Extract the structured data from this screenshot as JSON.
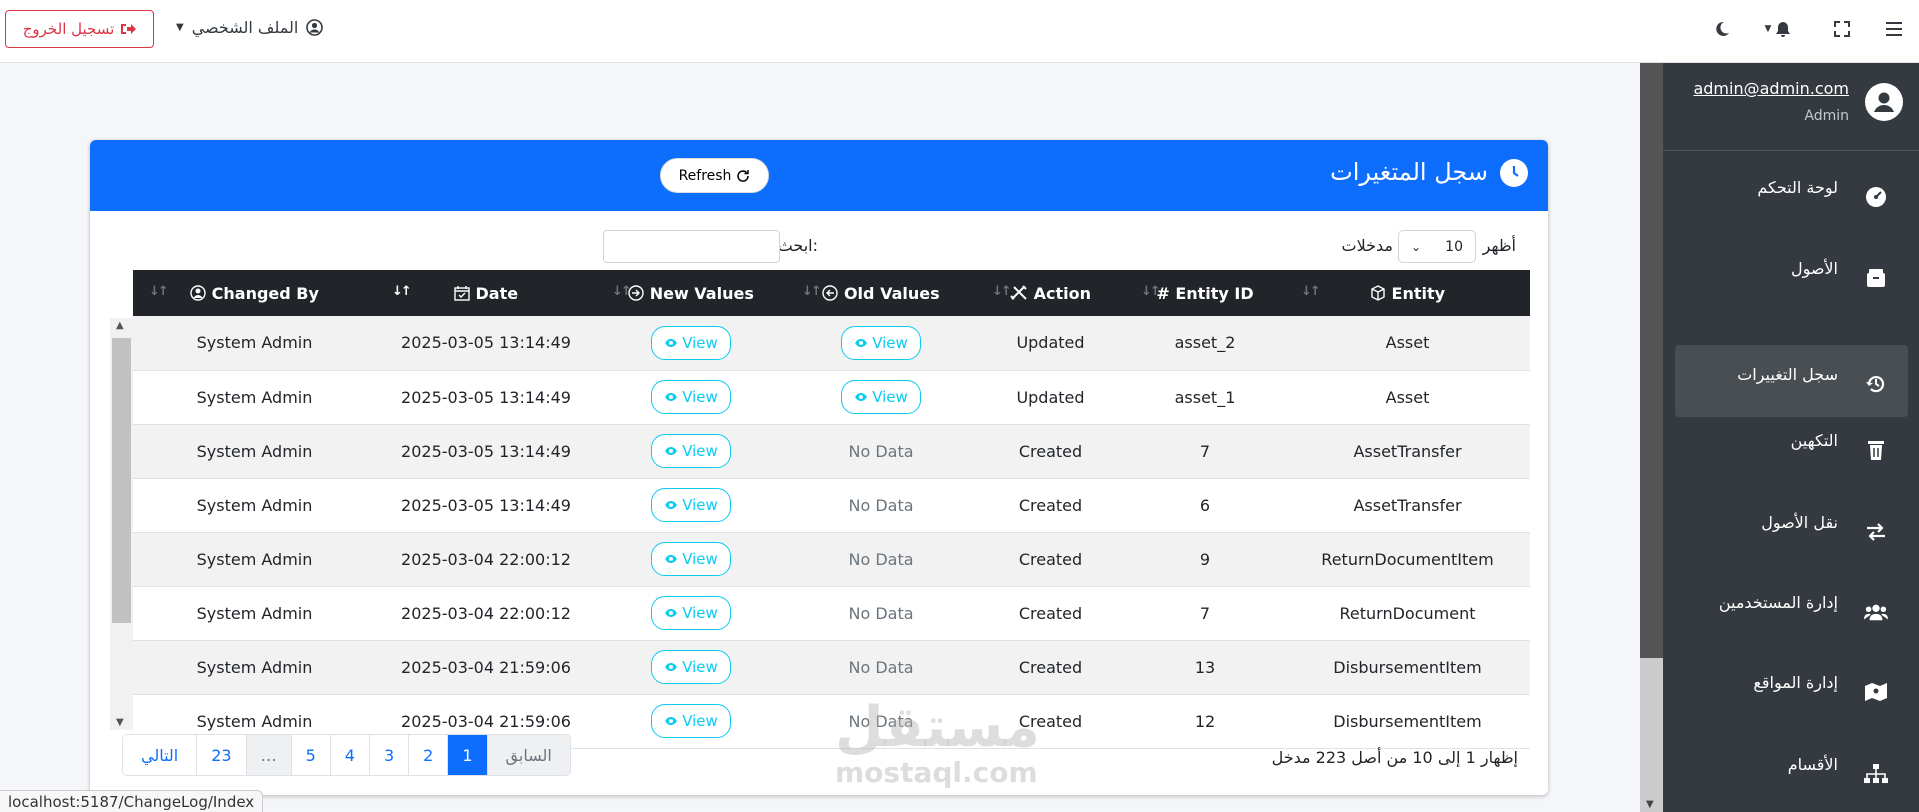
{
  "topbar": {
    "logout_label": "تسجيل الخروج",
    "profile_label": "الملف الشخصي"
  },
  "sidebar": {
    "user_email": "admin@admin.com",
    "user_role": "Admin",
    "items": [
      {
        "label": "لوحة التحكم",
        "icon": "dashboard-icon"
      },
      {
        "label": "الأصول",
        "icon": "box-icon"
      },
      {
        "label": "سجل التغييرات",
        "icon": "history-icon",
        "active": true
      },
      {
        "label": "التكهين",
        "icon": "trash-icon"
      },
      {
        "label": "نقل الأصول",
        "icon": "transfer-icon"
      },
      {
        "label": "إدارة المستخدمين",
        "icon": "users-icon"
      },
      {
        "label": "إدارة المواقع",
        "icon": "map-icon"
      },
      {
        "label": "الأقسام",
        "icon": "sitemap-icon"
      }
    ]
  },
  "card": {
    "title": "سجل المتغيرات",
    "refresh_label": "Refresh"
  },
  "controls": {
    "show_label": "أظهر",
    "page_length": "10",
    "entries_label": "مدخلات",
    "search_label": "ابحث:",
    "search_value": ""
  },
  "table": {
    "columns": [
      "Entity",
      "Entity ID",
      "Action",
      "Old Values",
      "New Values",
      "Date",
      "Changed By"
    ],
    "view_label": "View",
    "no_data_label": "No Data",
    "rows": [
      {
        "entity": "Asset",
        "entity_id": "asset_2",
        "action": "Updated",
        "old": "View",
        "new": "View",
        "date": "2025-03-05 13:14:49",
        "by": "System Admin"
      },
      {
        "entity": "Asset",
        "entity_id": "asset_1",
        "action": "Updated",
        "old": "View",
        "new": "View",
        "date": "2025-03-05 13:14:49",
        "by": "System Admin"
      },
      {
        "entity": "AssetTransfer",
        "entity_id": "7",
        "action": "Created",
        "old": "No Data",
        "new": "View",
        "date": "2025-03-05 13:14:49",
        "by": "System Admin"
      },
      {
        "entity": "AssetTransfer",
        "entity_id": "6",
        "action": "Created",
        "old": "No Data",
        "new": "View",
        "date": "2025-03-05 13:14:49",
        "by": "System Admin"
      },
      {
        "entity": "ReturnDocumentItem",
        "entity_id": "9",
        "action": "Created",
        "old": "No Data",
        "new": "View",
        "date": "2025-03-04 22:00:12",
        "by": "System Admin"
      },
      {
        "entity": "ReturnDocument",
        "entity_id": "7",
        "action": "Created",
        "old": "No Data",
        "new": "View",
        "date": "2025-03-04 22:00:12",
        "by": "System Admin"
      },
      {
        "entity": "DisbursementItem",
        "entity_id": "13",
        "action": "Created",
        "old": "No Data",
        "new": "View",
        "date": "2025-03-04 21:59:06",
        "by": "System Admin"
      },
      {
        "entity": "DisbursementItem",
        "entity_id": "12",
        "action": "Created",
        "old": "No Data",
        "new": "View",
        "date": "2025-03-04 21:59:06",
        "by": "System Admin"
      }
    ]
  },
  "footer": {
    "info": "إظهار 1 إلى 10 من أصل 223 مدخل",
    "pagination": [
      "السابق",
      "1",
      "2",
      "3",
      "4",
      "5",
      "…",
      "23",
      "التالي"
    ],
    "current_page": "1"
  },
  "watermark": {
    "top": "مستقل",
    "bottom": "mostaql.com"
  },
  "statusbar": "localhost:5187/ChangeLog/Index"
}
